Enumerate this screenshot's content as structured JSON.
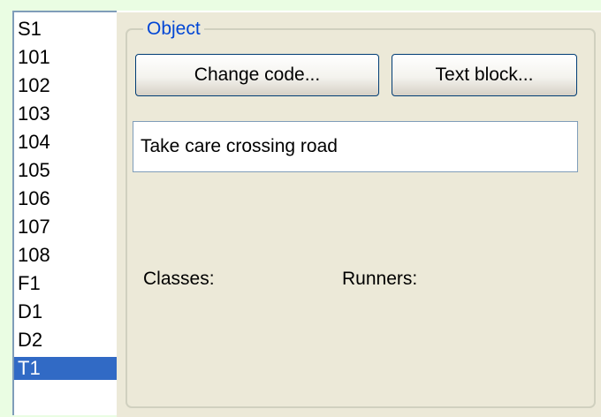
{
  "course_list": {
    "items": [
      "S1",
      "101",
      "102",
      "103",
      "104",
      "105",
      "106",
      "107",
      "108",
      "F1",
      "D1",
      "D2",
      "T1"
    ],
    "selected": "T1"
  },
  "object_panel": {
    "title": "Object",
    "change_code_label": "Change code...",
    "text_block_label": "Text block...",
    "description_value": "Take care crossing road",
    "classes_label": "Classes:",
    "runners_label": "Runners:"
  }
}
